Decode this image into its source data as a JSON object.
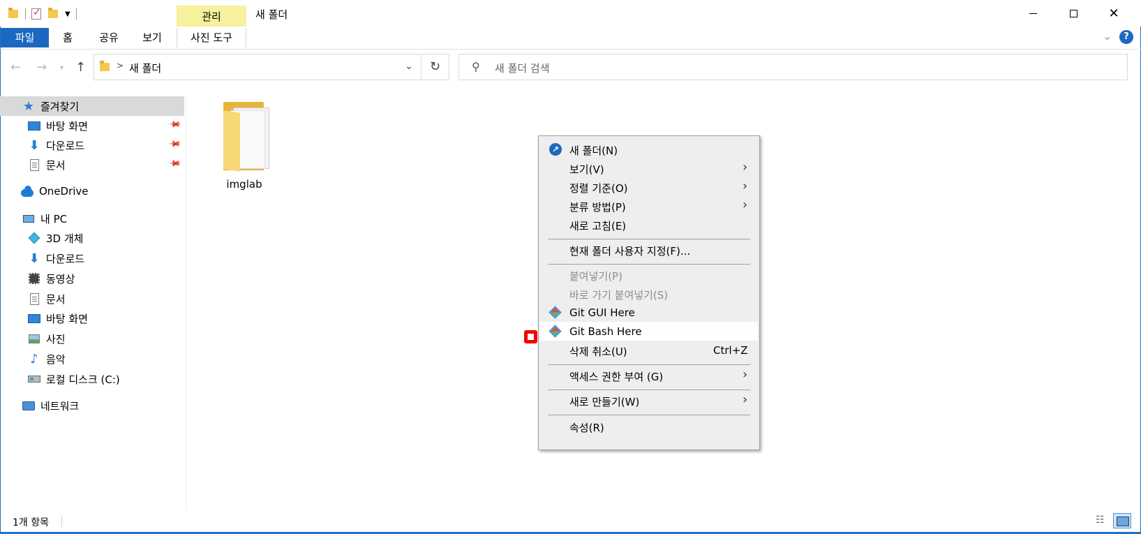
{
  "title_bar": {
    "manage_tab": "관리",
    "window_title": "새 폴더",
    "minimize": "minimize",
    "maximize": "maximize",
    "close_icon": "✕"
  },
  "ribbon": {
    "tabs": [
      "파일",
      "홈",
      "공유",
      "보기",
      "사진 도구"
    ],
    "help": "?"
  },
  "address": {
    "breadcrumb": "새 폴더",
    "search_placeholder": "새 폴더 검색"
  },
  "sidebar": {
    "items": [
      {
        "label": "즐겨찾기",
        "icon": "star-icon"
      },
      {
        "label": "바탕 화면",
        "icon": "desktop-icon",
        "pinned": true
      },
      {
        "label": "다운로드",
        "icon": "download-icon",
        "pinned": true
      },
      {
        "label": "문서",
        "icon": "document-icon",
        "pinned": true
      },
      {
        "label": "OneDrive",
        "icon": "cloud-icon"
      },
      {
        "label": "내 PC",
        "icon": "pc-icon"
      },
      {
        "label": "3D 개체",
        "icon": "cube-icon"
      },
      {
        "label": "다운로드",
        "icon": "download-icon"
      },
      {
        "label": "동영상",
        "icon": "video-icon"
      },
      {
        "label": "문서",
        "icon": "document-icon"
      },
      {
        "label": "바탕 화면",
        "icon": "desktop-icon"
      },
      {
        "label": "사진",
        "icon": "picture-icon"
      },
      {
        "label": "음악",
        "icon": "music-icon"
      },
      {
        "label": "로컬 디스크 (C:)",
        "icon": "disk-icon"
      },
      {
        "label": "네트워크",
        "icon": "network-icon"
      }
    ]
  },
  "content": {
    "files": [
      {
        "name": "imglab",
        "type": "folder"
      }
    ]
  },
  "context_menu": {
    "items": [
      {
        "label": "새 폴더(N)",
        "icon": "new-folder-icon"
      },
      {
        "label": "보기(V)",
        "submenu": true
      },
      {
        "label": "정렬 기준(O)",
        "submenu": true
      },
      {
        "label": "분류 방법(P)",
        "submenu": true
      },
      {
        "label": "새로 고침(E)"
      },
      {
        "label": "현재 폴더 사용자 지정(F)..."
      },
      {
        "label": "붙여넣기(P)",
        "disabled": true
      },
      {
        "label": "바로 가기 붙여넣기(S)",
        "disabled": true
      },
      {
        "label": "Git GUI Here",
        "icon": "git-icon"
      },
      {
        "label": "Git Bash Here",
        "icon": "git-icon",
        "highlighted": true
      },
      {
        "label": "삭제 취소(U)",
        "shortcut": "Ctrl+Z"
      },
      {
        "label": "액세스 권한 부여 (G)",
        "submenu": true
      },
      {
        "label": "새로 만들기(W)",
        "submenu": true
      },
      {
        "label": "속성(R)"
      }
    ]
  },
  "status_bar": {
    "item_count": "1개 항목"
  }
}
